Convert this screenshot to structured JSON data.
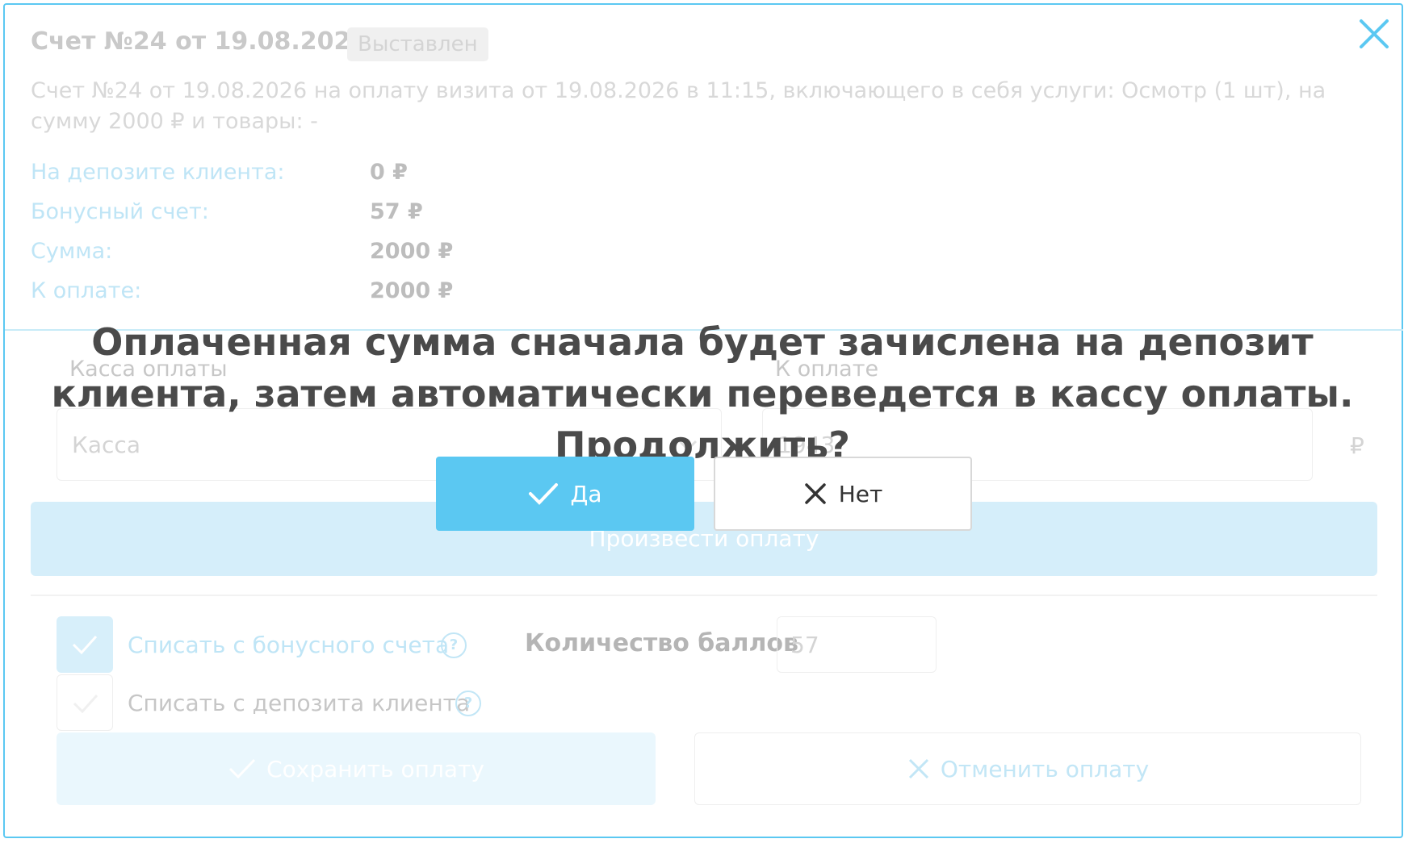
{
  "invoice": {
    "title": "Счет №24 от 19.08.2026",
    "status": "Выставлен",
    "description": "Счет №24 от 19.08.2026 на оплату визита от 19.08.2026 в 11:15, включающего в себя услуги: Осмотр (1 шт), на сумму 2000 ₽ и товары: -"
  },
  "info_rows": [
    {
      "label": "На депозите клиента:",
      "value": "0 ₽"
    },
    {
      "label": "Бонусный счет:",
      "value": "57 ₽"
    },
    {
      "label": "Сумма:",
      "value": "2000 ₽"
    },
    {
      "label": "К оплате:",
      "value": "2000 ₽"
    }
  ],
  "payment_form": {
    "cashbox_label": "Касса оплаты",
    "cashbox_value": "Касса",
    "amount_label": "К оплате",
    "amount_value": "1943",
    "currency": "₽",
    "pay_button": "Произвести оплату"
  },
  "options": {
    "bonus_label": "Списать с бонусного счета",
    "bonus_checked": true,
    "deposit_label": "Списать с депозита клиента",
    "deposit_checked": false,
    "points_label": "Количество баллов",
    "points_value": "57"
  },
  "footer": {
    "save_button": "Сохранить оплату",
    "cancel_button": "Отменить оплату"
  },
  "confirm_dialog": {
    "question": "Оплаченная сумма сначала будет зачислена на депозит клиента, затем автоматически переведется в кассу оплаты. Продолжить?",
    "yes_button": "Да",
    "no_button": "Нет"
  },
  "colors": {
    "accent": "#5bc8f2",
    "text_dark": "#4a4a4a"
  },
  "icons": {
    "close": "close-icon",
    "chevron": "chevron-down-icon",
    "check": "check-icon",
    "cross": "cross-icon",
    "help": "help-circle-icon"
  }
}
